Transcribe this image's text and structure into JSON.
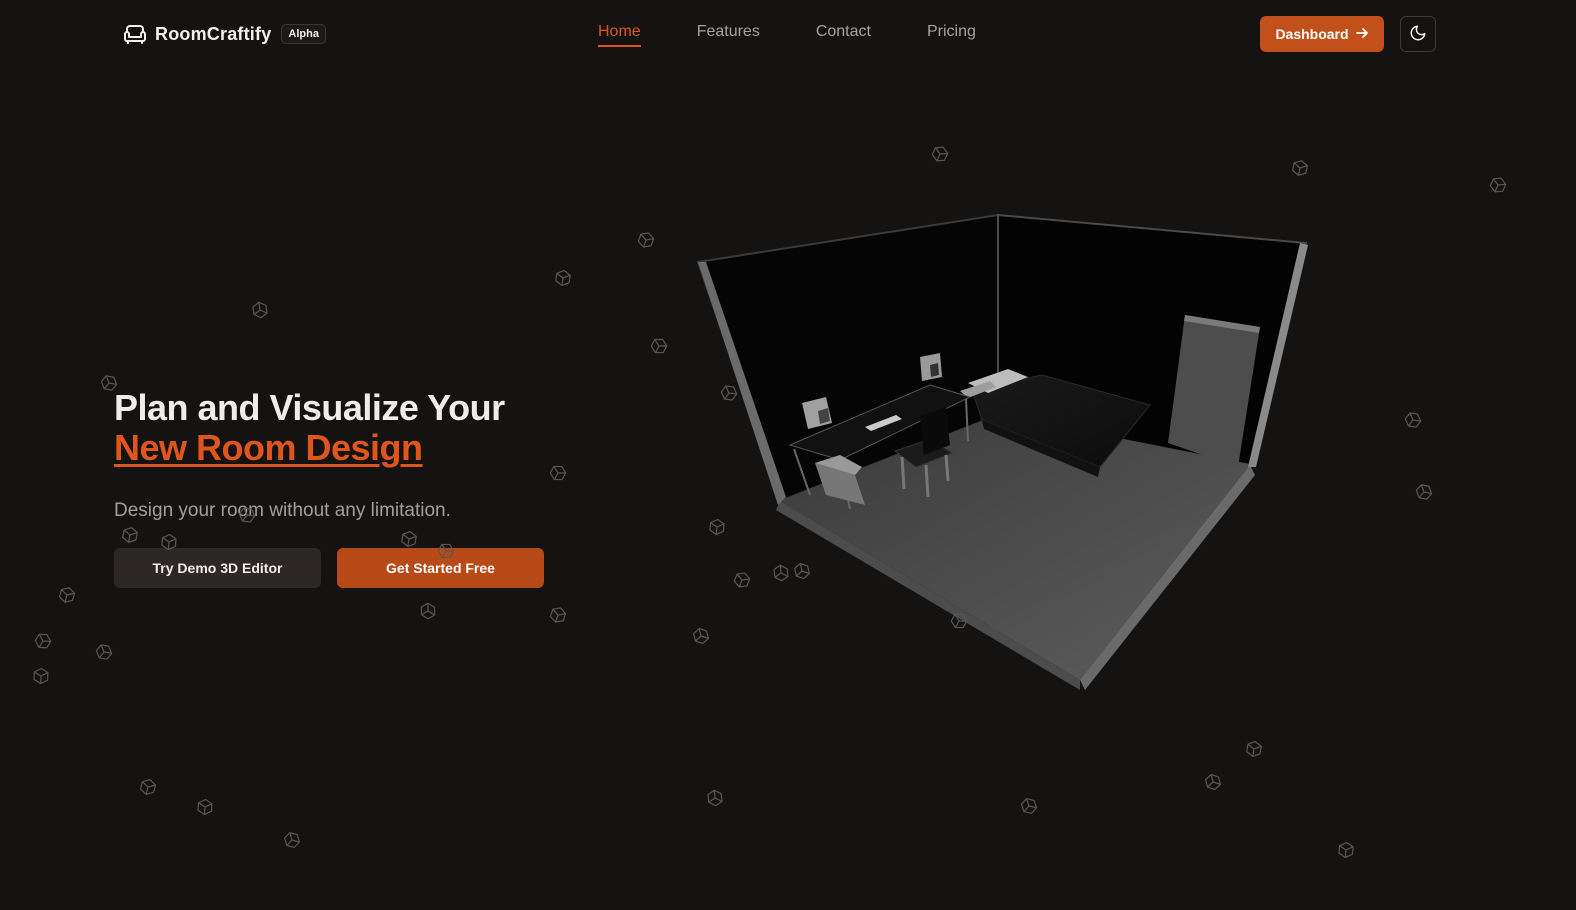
{
  "brand": {
    "name": "RoomCraftify",
    "badge": "Alpha",
    "logo_icon": "sofa-icon"
  },
  "nav": {
    "links": [
      {
        "label": "Home",
        "active": true
      },
      {
        "label": "Features",
        "active": false
      },
      {
        "label": "Contact",
        "active": false
      },
      {
        "label": "Pricing",
        "active": false
      }
    ]
  },
  "header_actions": {
    "dashboard_label": "Dashboard",
    "dashboard_icon": "arrow-right-icon",
    "theme_toggle_icon": "moon-icon"
  },
  "hero": {
    "title_line1": "Plan and Visualize Your",
    "title_line2": "New Room Design",
    "subtitle": "Design your room without any limitation.",
    "demo_button": "Try Demo 3D Editor",
    "start_button": "Get Started Free"
  },
  "colors": {
    "background": "#151312",
    "accent": "#e0551c",
    "primary_button": "#c2501a",
    "secondary_button": "#2d2725",
    "muted_text": "#a6a19c"
  },
  "decorations": {
    "particle_icon": "cube-icon",
    "scene": "3d-room-preview"
  }
}
